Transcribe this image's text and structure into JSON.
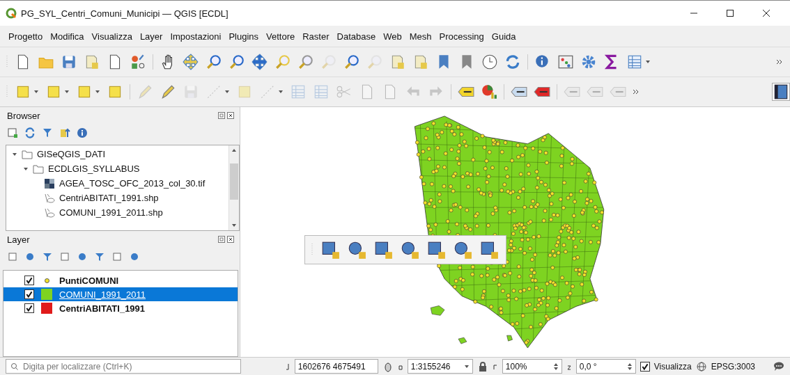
{
  "window": {
    "title": "PG_SYL_Centri_Comuni_Municipi — QGIS [ECDL]"
  },
  "menu": [
    "Progetto",
    "Modifica",
    "Visualizza",
    "Layer",
    "Impostazioni",
    "Plugins",
    "Vettore",
    "Raster",
    "Database",
    "Web",
    "Mesh",
    "Processing",
    "Guida"
  ],
  "browser": {
    "title": "Browser",
    "tree": [
      {
        "label": "GISeQGIS_DATI",
        "kind": "folder",
        "expanded": true,
        "children": [
          {
            "label": "ECDLGIS_SYLLABUS",
            "kind": "folder",
            "expanded": true,
            "children": [
              {
                "label": "AGEA_TOSC_OFC_2013_col_30.tif",
                "kind": "raster"
              },
              {
                "label": "CentriABITATI_1991.shp",
                "kind": "vector"
              },
              {
                "label": "COMUNI_1991_2011.shp",
                "kind": "vector"
              }
            ]
          }
        ]
      }
    ]
  },
  "layers": {
    "title": "Layer",
    "items": [
      {
        "name": "PuntiCOMUNI",
        "kind": "point",
        "checked": true,
        "selected": false,
        "color": "#f2e227"
      },
      {
        "name": "COMUNI_1991_2011",
        "kind": "polygon",
        "checked": true,
        "selected": true,
        "color": "#7ed321"
      },
      {
        "name": "CentriABITATI_1991",
        "kind": "polygon",
        "checked": true,
        "selected": false,
        "color": "#e01b1b"
      }
    ]
  },
  "status_bar": {
    "search_placeholder": "Digita per localizzare (Ctrl+K)",
    "coordinate": "1602676 4675491",
    "scale": "1:3155246",
    "magnifier": "100%",
    "rotation": "0,0 °",
    "render": {
      "label": "Visualizza",
      "checked": true
    },
    "crs": "EPSG:3003"
  }
}
